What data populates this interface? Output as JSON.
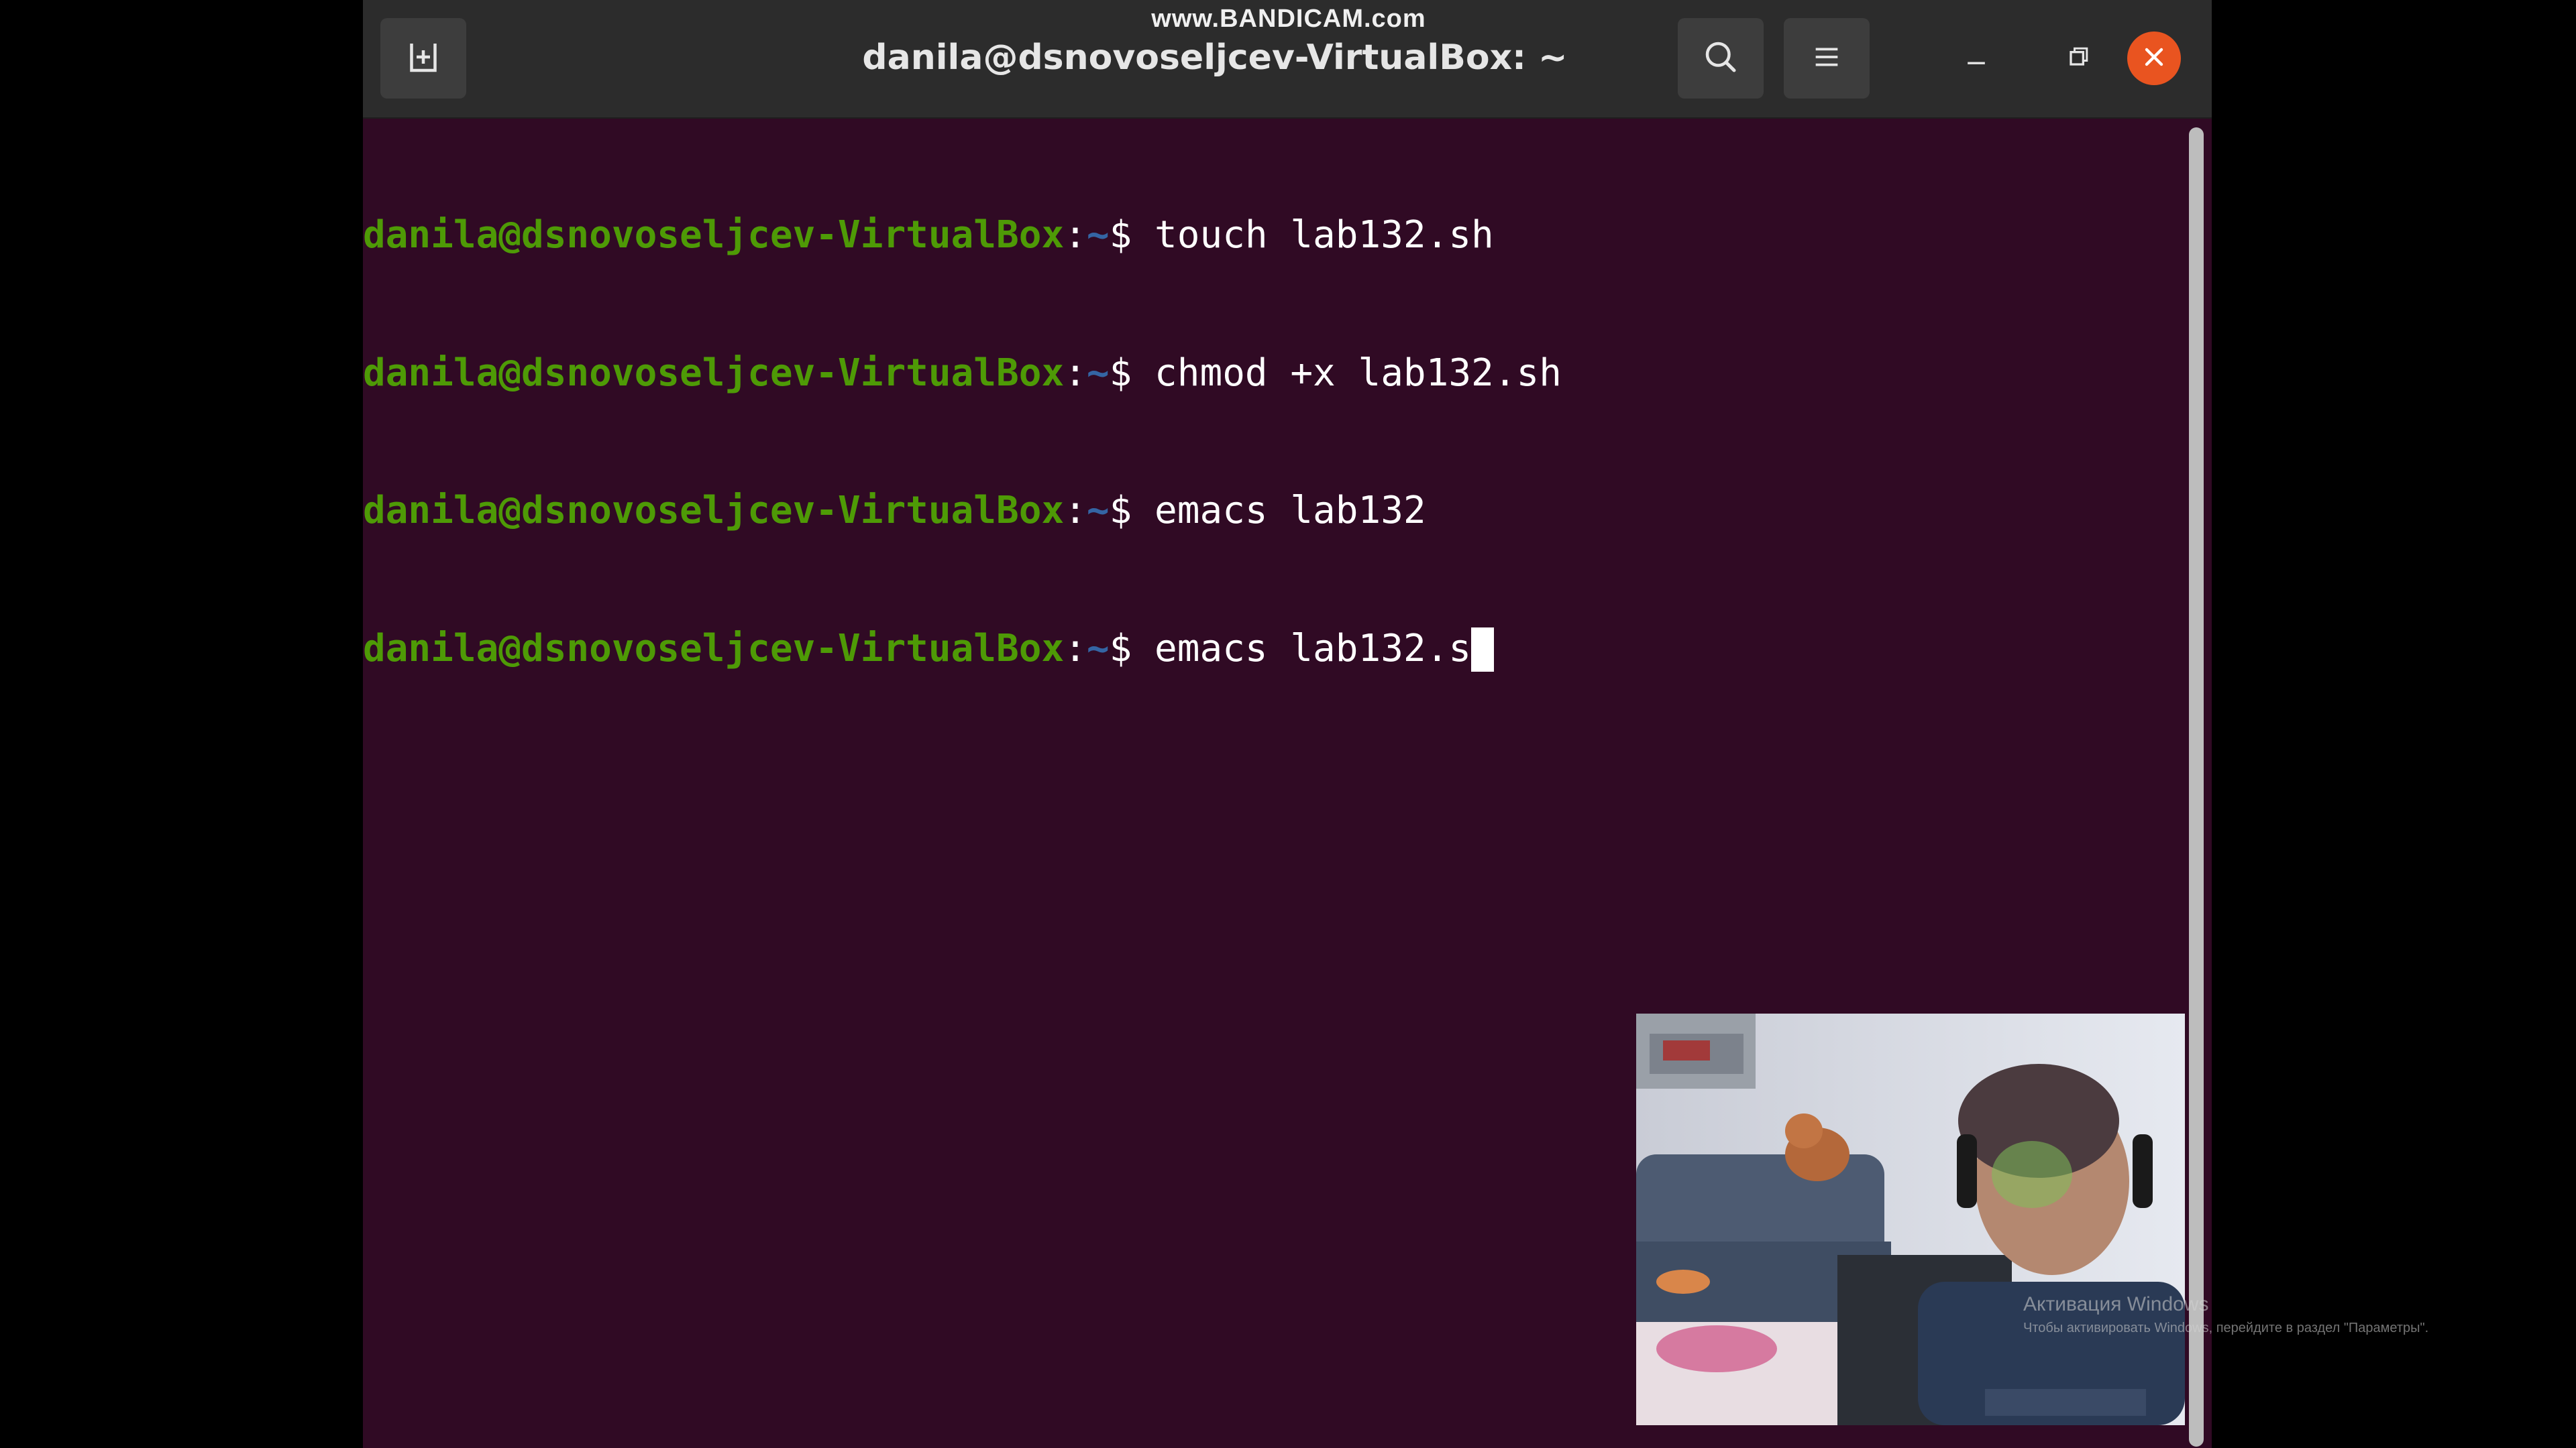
{
  "watermark": "www.BANDICAM.com",
  "window": {
    "title": "danila@dsnovoseljcev-VirtualBox: ~"
  },
  "terminal": {
    "prompt_user": "danila@dsnovoseljcev-VirtualBox",
    "prompt_colon": ":",
    "prompt_path": "~",
    "prompt_dollar": "$ ",
    "lines": [
      {
        "command": "touch lab132.sh"
      },
      {
        "command": "chmod +x lab132.sh"
      },
      {
        "command": "emacs lab132"
      },
      {
        "command": "emacs lab132.s"
      }
    ]
  },
  "activation": {
    "title": "Активация Windows",
    "subtitle": "Чтобы активировать Windows, перейдите в раздел \"Параметры\"."
  },
  "icons": {
    "new_tab": "new-tab-icon",
    "search": "search-icon",
    "menu": "hamburger-menu-icon",
    "minimize": "minimize-icon",
    "restore": "restore-icon",
    "close": "close-icon"
  },
  "colors": {
    "terminal_bg": "#300a24",
    "prompt_user": "#4e9a06",
    "prompt_path": "#3465a4",
    "close_button": "#e95420",
    "titlebar": "#2c2c2c"
  }
}
